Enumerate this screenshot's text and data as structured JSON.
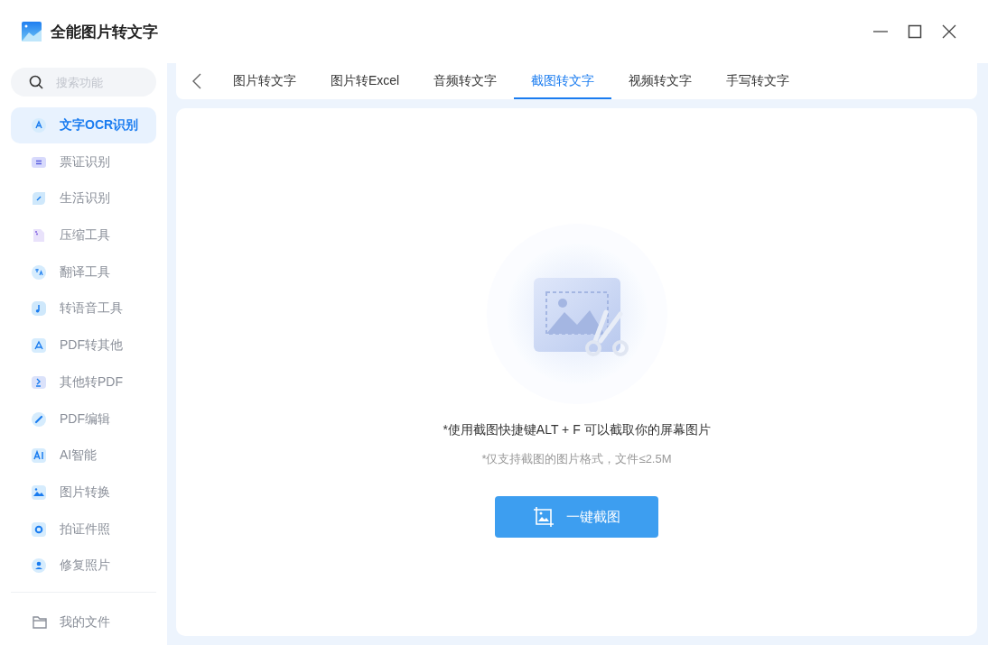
{
  "window": {
    "title": "全能图片转文字"
  },
  "sidebar": {
    "search": {
      "placeholder": "搜索功能"
    },
    "items": [
      {
        "kind": "ocr",
        "label": "文字OCR识别",
        "selected": true
      },
      {
        "kind": "ticket",
        "label": "票证识别",
        "selected": false
      },
      {
        "kind": "leaf",
        "label": "生活识别",
        "selected": false
      },
      {
        "kind": "compress",
        "label": "压缩工具",
        "selected": false
      },
      {
        "kind": "translate",
        "label": "翻译工具",
        "selected": false
      },
      {
        "kind": "music",
        "label": "转语音工具",
        "selected": false
      },
      {
        "kind": "pdf",
        "label": "PDF转其他",
        "selected": false
      },
      {
        "kind": "topdf",
        "label": "其他转PDF",
        "selected": false
      },
      {
        "kind": "edit",
        "label": "PDF编辑",
        "selected": false
      },
      {
        "kind": "ai",
        "label": "AI智能",
        "selected": false
      },
      {
        "kind": "image",
        "label": "图片转换",
        "selected": false
      },
      {
        "kind": "camera",
        "label": "拍证件照",
        "selected": false
      },
      {
        "kind": "person",
        "label": "修复照片",
        "selected": false
      }
    ],
    "footer": {
      "label": "我的文件"
    }
  },
  "tabs": [
    {
      "label": "图片转文字",
      "selected": false
    },
    {
      "label": "图片转Excel",
      "selected": false
    },
    {
      "label": "音频转文字",
      "selected": false
    },
    {
      "label": "截图转文字",
      "selected": true
    },
    {
      "label": "视频转文字",
      "selected": false
    },
    {
      "label": "手写转文字",
      "selected": false
    }
  ],
  "main": {
    "hint": "*使用截图快捷键ALT + F 可以截取你的屏幕图片",
    "note": "*仅支持截图的图片格式，文件≤2.5M",
    "button": "一键截图"
  }
}
